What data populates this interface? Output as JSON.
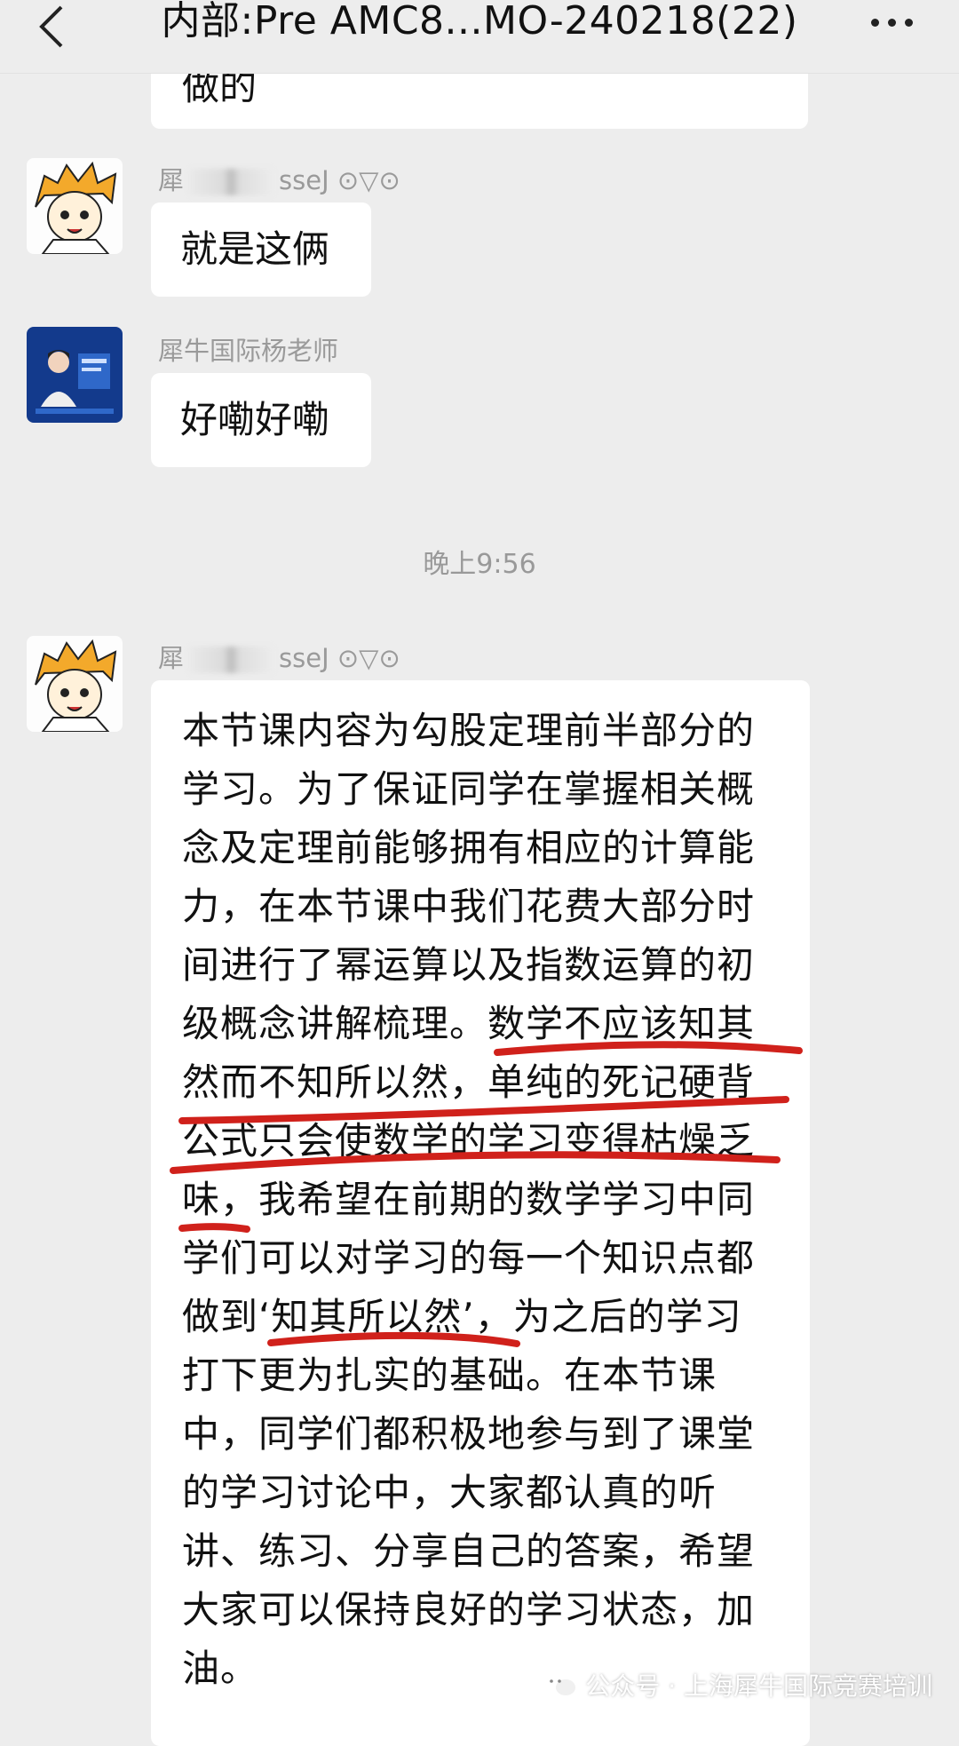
{
  "header": {
    "title": "内部:Pre AMC8...MO-240218(22)"
  },
  "messages": {
    "top_partial": "做的",
    "msg1": {
      "sender_prefix": "犀",
      "sender_suffix": "sseJ ⊙▽⊙",
      "text": "就是这俩"
    },
    "msg2": {
      "sender": "犀牛国际杨老师",
      "text": "好嘞好嘞"
    },
    "timestamp": "晚上9:56",
    "msg3": {
      "sender_prefix": "犀",
      "sender_suffix": "sseJ ⊙▽⊙",
      "lines": [
        "本节课内容为勾股定理前半部分的",
        "学习。为了保证同学在掌握相关概",
        "念及定理前能够拥有相应的计算能",
        "力，在本节课中我们花费大部分时",
        "间进行了幂运算以及指数运算的初",
        "级概念讲解梳理。数学不应该知其",
        "然而不知所以然，单纯的死记硬背",
        "公式只会使数学的学习变得枯燥乏",
        "味，我希望在前期的数学学习中同",
        "学们可以对学习的每一个知识点都",
        "做到‘知其所以然’，为之后的学习",
        "打下更为扎实的基础。在本节课",
        "中，同学们都积极地参与到了课堂",
        "的学习讨论中，大家都认真的听",
        "讲、练习、分享自己的答案，希望",
        "大家可以保持良好的学习状态，加",
        "油。"
      ]
    }
  },
  "watermark": "公众号 · 上海犀牛国际竞赛培训",
  "colors": {
    "background": "#ededed",
    "bubble": "#ffffff",
    "underline": "#d0211b"
  }
}
